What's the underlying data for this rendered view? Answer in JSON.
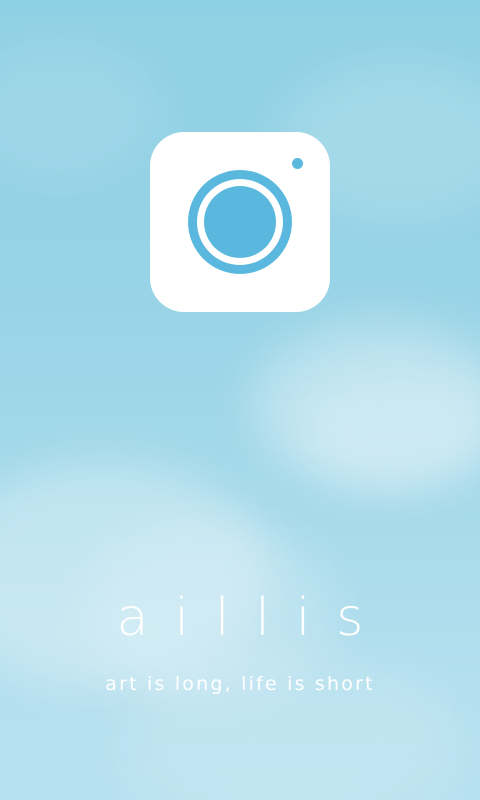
{
  "splash": {
    "app_name": "aillis",
    "tagline": "art is long, life is short"
  },
  "icons": {
    "app_logo": "camera-icon"
  },
  "colors": {
    "sky_top": "#8fd1e4",
    "sky_bottom": "#b8e1ef",
    "logo_background": "#ffffff",
    "logo_accent": "#5ab8de",
    "text": "#ffffff"
  }
}
